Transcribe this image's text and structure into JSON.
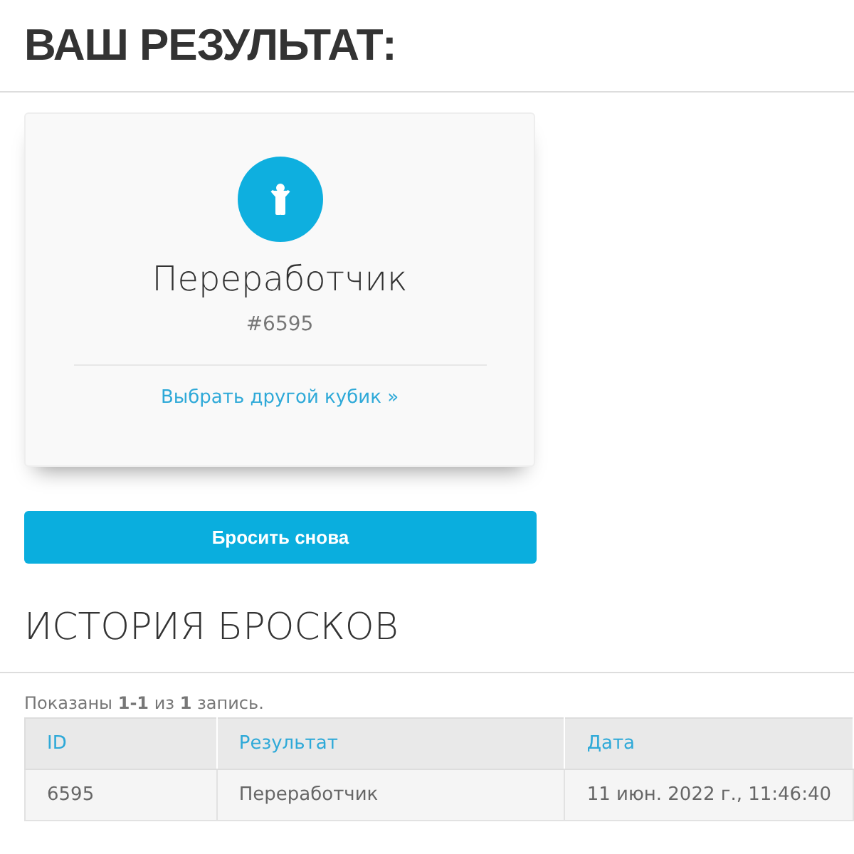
{
  "title": "ВАШ РЕЗУЛЬТАТ:",
  "result": {
    "name": "Переработчик",
    "number": "#6595",
    "link": "Выбрать другой кубик",
    "link_icon": "»"
  },
  "button": "Бросить снова",
  "history_title": "ИСТОРИЯ БРОСКОВ",
  "summary": "Показаны **1-1** из **1** запись.",
  "table": {
    "columns": [
      "ID",
      "Результат",
      "Дата"
    ],
    "rows": [
      [
        "6595",
        "Переработчик",
        "11 июн. 2022 г., 11:46:40"
      ]
    ]
  }
}
